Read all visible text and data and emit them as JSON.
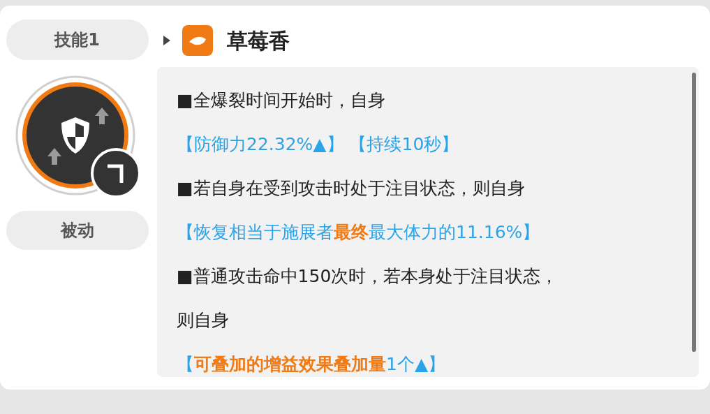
{
  "skill_label": "技能1",
  "skill_type": "被动",
  "title": "草莓香",
  "lines": [
    {
      "segments": [
        {
          "text": "■全爆裂时间开始时，自身",
          "kind": "plain"
        }
      ]
    },
    {
      "segments": [
        {
          "text": "【防御力22.32%▲】 【持续10秒】",
          "kind": "value"
        }
      ]
    },
    {
      "segments": [
        {
          "text": "■若自身在受到攻击时处于注目状态，则自身",
          "kind": "plain"
        }
      ]
    },
    {
      "segments": [
        {
          "text": "【恢复相当于施展者",
          "kind": "value"
        },
        {
          "text": "最终",
          "kind": "emphasis"
        },
        {
          "text": "最大体力的11.16%】",
          "kind": "value"
        }
      ]
    },
    {
      "segments": [
        {
          "text": "■普通攻击命中150次时，若本身处于注目状态，",
          "kind": "plain"
        }
      ]
    },
    {
      "segments": [
        {
          "text": "则自身",
          "kind": "plain"
        }
      ]
    },
    {
      "segments": [
        {
          "text": "【",
          "kind": "value"
        },
        {
          "text": "可叠加的增益效果叠加量",
          "kind": "emphasis"
        },
        {
          "text": "1个▲】",
          "kind": "value"
        }
      ]
    }
  ]
}
